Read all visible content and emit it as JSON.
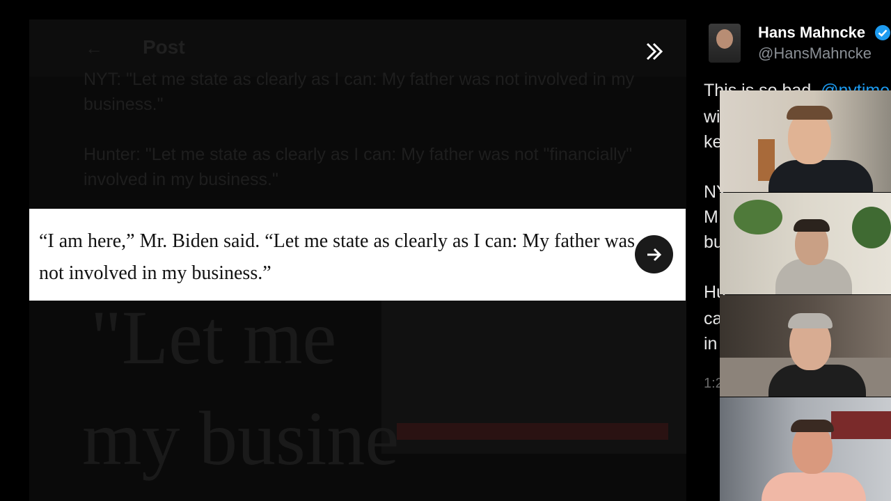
{
  "header": {
    "title": "Post"
  },
  "background_text": {
    "line1": "NYT: \"Let me state as clearly as I can: My father was not involved in my business.\"",
    "line2": "Hunter: \"Let me state as clearly as I can: My father was not \"financially\" involved in my business.\"",
    "big_a": "\"Let me",
    "big_b": "my busine"
  },
  "quote": {
    "text": "“I am here,” Mr. Biden said. “Let me state as clearly as I can: My father was not involved in my business.”"
  },
  "author": {
    "name": "Hans Mahncke",
    "handle": "@HansMahncke"
  },
  "tweet": {
    "line1_start": "This is so bad. ",
    "line1_mention": "@nytime",
    "line2": "wi",
    "line3": "ke",
    "line4": "NY",
    "line5": "M",
    "line6": "bu",
    "line7": "Hu",
    "line8": "ca",
    "line9": "in",
    "time": "1:2"
  },
  "icons": {
    "back": "back-arrow-icon",
    "expand": "double-chevron-right-icon",
    "next": "arrow-right-icon",
    "verified": "verified-badge-icon"
  },
  "colors": {
    "verified": "#1d9bf0",
    "link": "#1d9bf0"
  }
}
